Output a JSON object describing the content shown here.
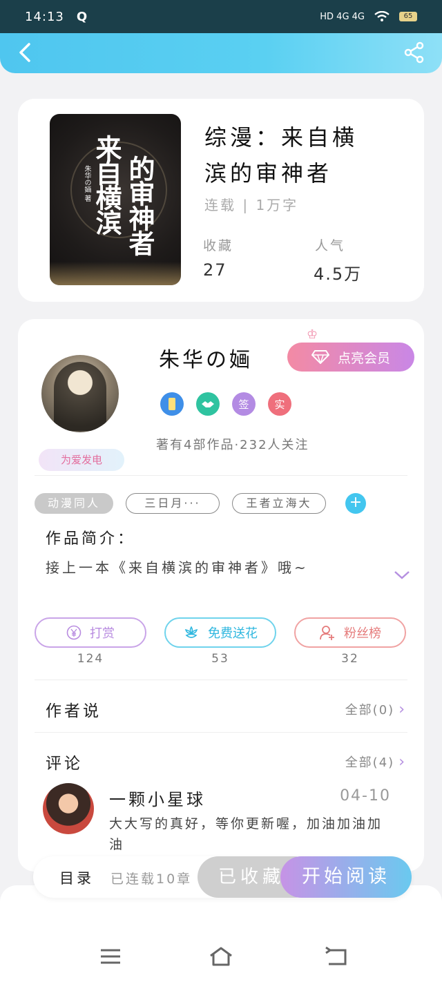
{
  "status_bar": {
    "time": "14:13",
    "app_icon": "Q",
    "network": "HD 4G 4G",
    "wifi_icon": "wifi-icon",
    "battery": "65"
  },
  "header": {
    "back_icon": "chevron-left-icon",
    "share_icon": "share-icon"
  },
  "book": {
    "title_line1": "综漫：来自横",
    "title_line2": "滨的审神者",
    "status": "连载 | 1万字",
    "cover_title": "来自横滨的审神者",
    "cover_title_col1": "来自横滨",
    "cover_title_col2": "的审神者",
    "cover_author": "朱华の婳 著",
    "stats": [
      {
        "label": "收藏",
        "value": "27"
      },
      {
        "label": "人气",
        "value": "4.5万"
      }
    ]
  },
  "author": {
    "name": "朱华の婳",
    "vip_button": "点亮会员",
    "badge_label": "为爱发电",
    "badges": [
      {
        "text": "",
        "icon": "phone-badge-icon",
        "color": "#3f8fe8"
      },
      {
        "text": "",
        "icon": "handshake-badge-icon",
        "color": "#2fc3a0"
      },
      {
        "text": "签",
        "icon": "signed-badge-icon",
        "color": "#b38be3"
      },
      {
        "text": "实",
        "icon": "verified-badge-icon",
        "color": "#ef6f7c"
      }
    ],
    "stats_text": "著有4部作品·232人关注"
  },
  "tags": [
    "动漫同人",
    "三日月···",
    "王者立海大"
  ],
  "tag_add": "+",
  "intro": {
    "title": "作品简介：",
    "text": "接上一本《来自横滨的审神者》哦~"
  },
  "actions": [
    {
      "label": "打赏",
      "count": "124",
      "icon": "yen-icon",
      "color": "#b88be0"
    },
    {
      "label": "免费送花",
      "count": "53",
      "icon": "flower-icon",
      "color": "#49c8e8"
    },
    {
      "label": "粉丝榜",
      "count": "32",
      "icon": "fans-icon",
      "color": "#ef8b8b"
    }
  ],
  "author_says": {
    "title": "作者说",
    "more": "全部(0)"
  },
  "comments": {
    "title": "评论",
    "more": "全部(4)",
    "items": [
      {
        "name": "一颗小星球",
        "date": "04-10",
        "text": "大大写的真好，等你更新喔，加油加油加油"
      }
    ]
  },
  "bottom_bar": {
    "toc": "目录",
    "serial": "已连载10章",
    "favorited": "已收藏",
    "read": "开始阅读"
  },
  "colors": {
    "accent": "#4fc6ef",
    "vip": "#f38aa4",
    "purple": "#b88be0"
  }
}
